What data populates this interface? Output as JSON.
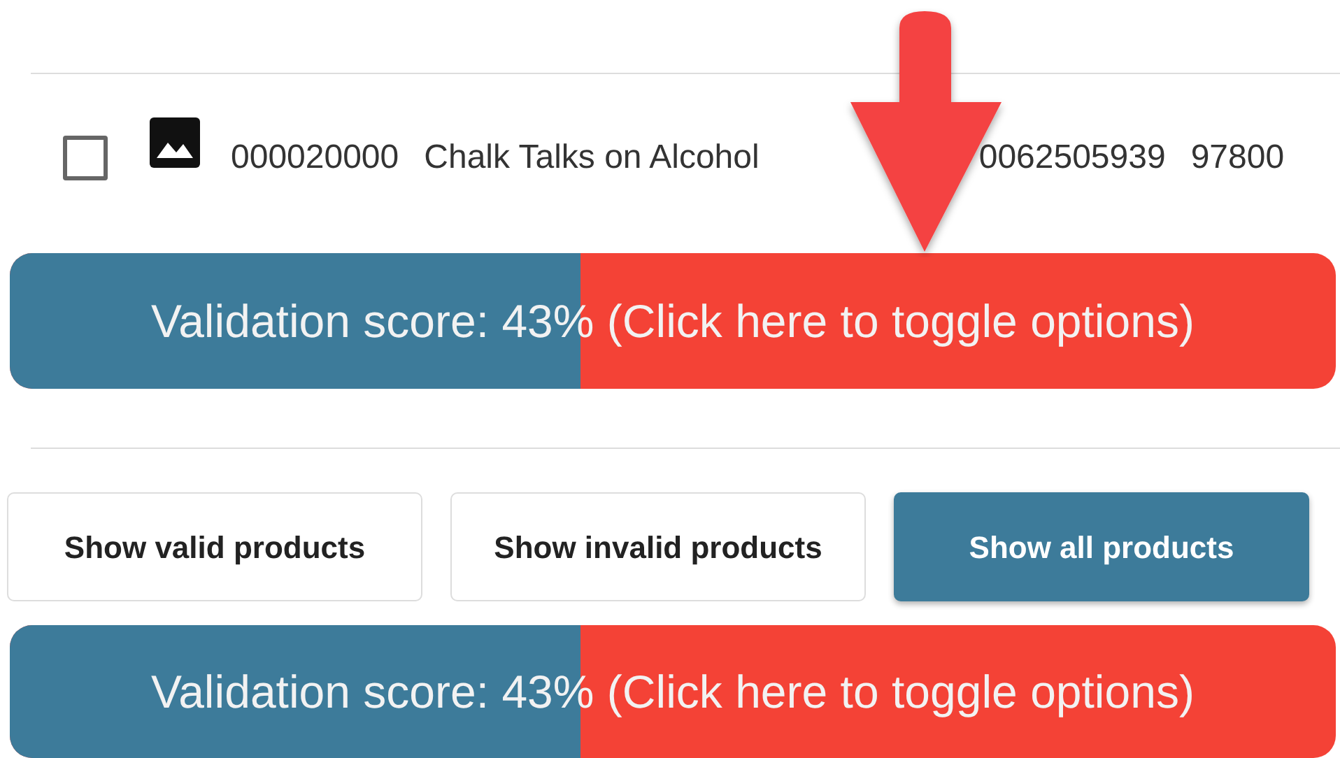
{
  "product_row": {
    "checked": false,
    "cells": [
      "000020000",
      "Chalk Talks on Alcohol",
      "0062505939",
      "97800"
    ]
  },
  "score_bars": [
    {
      "label": "Validation score: 43% (Click here to toggle options)",
      "level": 0.43
    },
    {
      "label": "Validation score: 43% (Click here to toggle options)",
      "level": 0.43
    }
  ],
  "filter_buttons": [
    {
      "label": "Show valid products",
      "selected": false
    },
    {
      "label": "Show invalid products",
      "selected": false
    },
    {
      "label": "Show all products",
      "selected": true
    }
  ]
}
